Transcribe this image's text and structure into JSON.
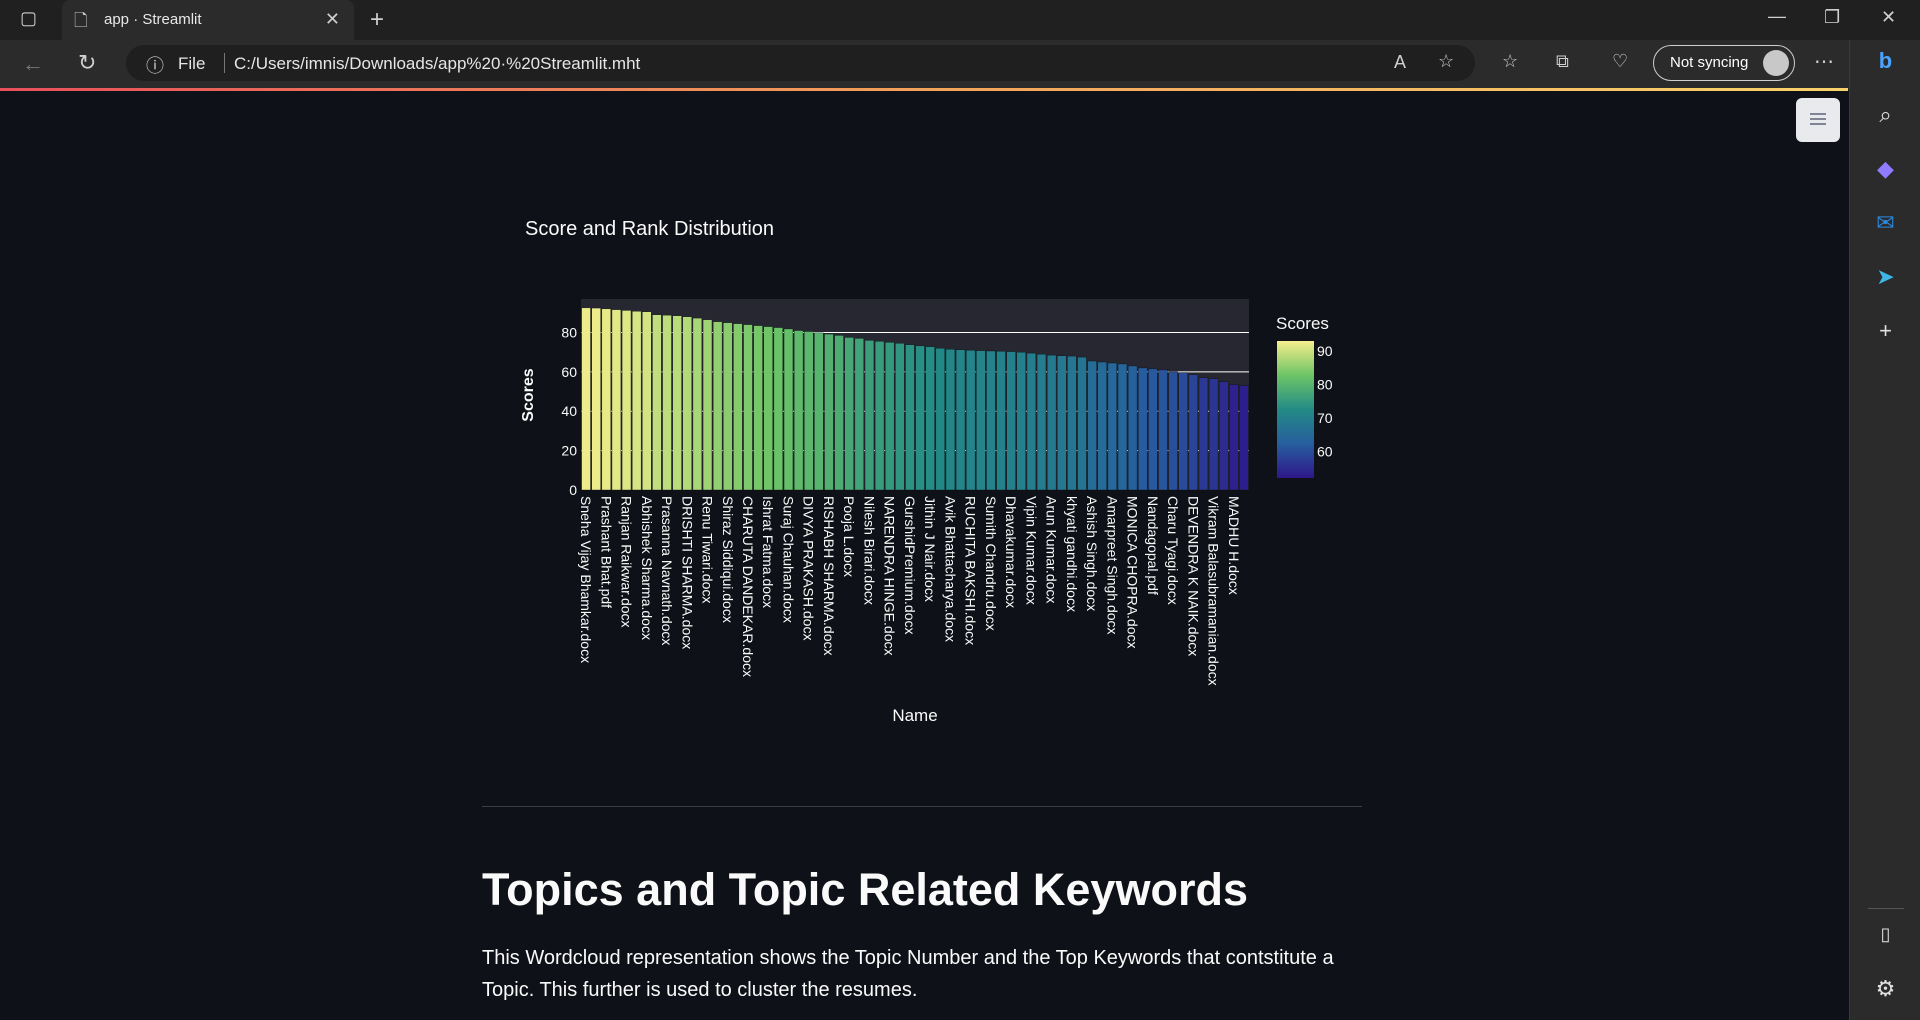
{
  "browser": {
    "tab_title": "app · Streamlit",
    "address_prefix": "File",
    "url": "C:/Users/imnis/Downloads/app%20·%20Streamlit.mht",
    "sync_label": "Not syncing"
  },
  "page": {
    "section_heading": "Topics and Topic Related Keywords",
    "section_description": "This Wordcloud representation shows the Topic Number and the Top Keywords that contstitute a Topic. This further is used to cluster the resumes."
  },
  "chart_data": {
    "type": "bar",
    "title": "Score and Rank Distribution",
    "xlabel": "Name",
    "ylabel": "Scores",
    "ylim": [
      0,
      97
    ],
    "yticks": [
      0,
      20,
      40,
      60,
      80
    ],
    "colorbar": {
      "title": "Scores",
      "ticks": [
        90,
        80,
        70,
        60
      ],
      "range": [
        52,
        93
      ],
      "colorscale": "Viridis-like (dark blue to yellow)"
    },
    "categories": [
      "Sneha Vijay Bhamkar.docx",
      "",
      "Prashant Bhat.pdf",
      "",
      "Ranjan Raikwar.docx",
      "",
      "Abhishek Sharma.docx",
      "",
      "Prasanna Navnath.docx",
      "",
      "DRISHTI SHARMA.docx",
      "",
      "Renu Tiwari.docx",
      "",
      "Shiraz Siddiqui.docx",
      "",
      "CHARUTA DANDEKAR.docx",
      "",
      "Ishrat Fatma.docx",
      "",
      "Suraj Chauhan.docx",
      "",
      "DIVYA PRAKASH.docx",
      "",
      "RISHABH SHARMA.docx",
      "",
      "Pooja L.docx",
      "",
      "Nilesh Birari.docx",
      "",
      "NARENDRA HINGE.docx",
      "",
      "GurshidPremium.docx",
      "",
      "Jithin J Nair.docx",
      "",
      "Avik Bhattacharya.docx",
      "",
      "RUCHITA BAKSHI.docx",
      "",
      "Sumith Chandru.docx",
      "",
      "Dhavakumar.docx",
      "",
      "Vipin Kumar.docx",
      "",
      "Arun Kumar.docx",
      "",
      "khyati gandhi.docx",
      "",
      "Ashish Singh.docx",
      "",
      "Amarpreet Singh.docx",
      "",
      "MONICA CHOPRA.docx",
      "",
      "Nandagopal.pdf",
      "",
      "Charu Tyagi.docx",
      "",
      "DEVENDRA K NAIK.docx",
      "",
      "Vikram Balasubramanian.docx",
      "",
      "MADHU H.docx",
      ""
    ],
    "values": [
      92.5,
      92.4,
      92.0,
      91.6,
      91.2,
      90.8,
      90.5,
      89.0,
      88.8,
      88.5,
      88.0,
      87.3,
      86.5,
      85.5,
      85.0,
      84.5,
      84.0,
      83.5,
      83.0,
      82.5,
      81.8,
      81.0,
      80.5,
      79.8,
      79.2,
      78.5,
      77.5,
      77.0,
      76.0,
      75.5,
      75.0,
      74.5,
      73.8,
      73.2,
      72.8,
      72.0,
      71.5,
      71.2,
      71.0,
      70.8,
      70.6,
      70.5,
      70.3,
      70.0,
      69.5,
      69.0,
      68.5,
      68.2,
      68.0,
      67.5,
      65.5,
      65.0,
      64.5,
      64.0,
      63.0,
      62.0,
      61.5,
      61.0,
      60.0,
      59.5,
      58.5,
      57.0,
      56.5,
      55.0,
      53.5,
      53.0
    ]
  }
}
